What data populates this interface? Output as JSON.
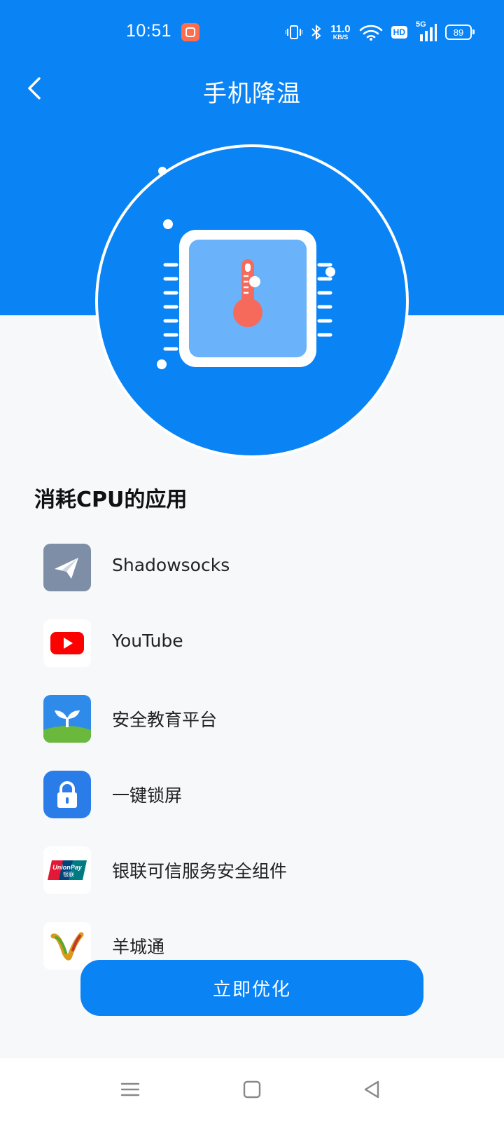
{
  "status_bar": {
    "time": "10:51",
    "net_speed_value": "11.0",
    "net_speed_unit": "KB/S",
    "hd": "HD",
    "network": "5G",
    "battery": "89"
  },
  "header": {
    "title": "手机降温"
  },
  "section": {
    "title": "消耗CPU的应用"
  },
  "apps": [
    {
      "name": "Shadowsocks",
      "icon": "paper-plane-icon"
    },
    {
      "name": "YouTube",
      "icon": "youtube-icon"
    },
    {
      "name": "安全教育平台",
      "icon": "sprout-icon"
    },
    {
      "name": "一键锁屏",
      "icon": "lock-icon"
    },
    {
      "name": "银联可信服务安全组件",
      "icon": "unionpay-icon",
      "logo_text": "UnionPay 银联"
    },
    {
      "name": "羊城通",
      "icon": "yct-logo-icon"
    }
  ],
  "actions": {
    "optimize_label": "立即优化"
  },
  "colors": {
    "primary": "#0a83f5",
    "thermometer": "#f56a5b",
    "chip_inner": "#6ab3fb",
    "background": "#f7f8fa"
  }
}
